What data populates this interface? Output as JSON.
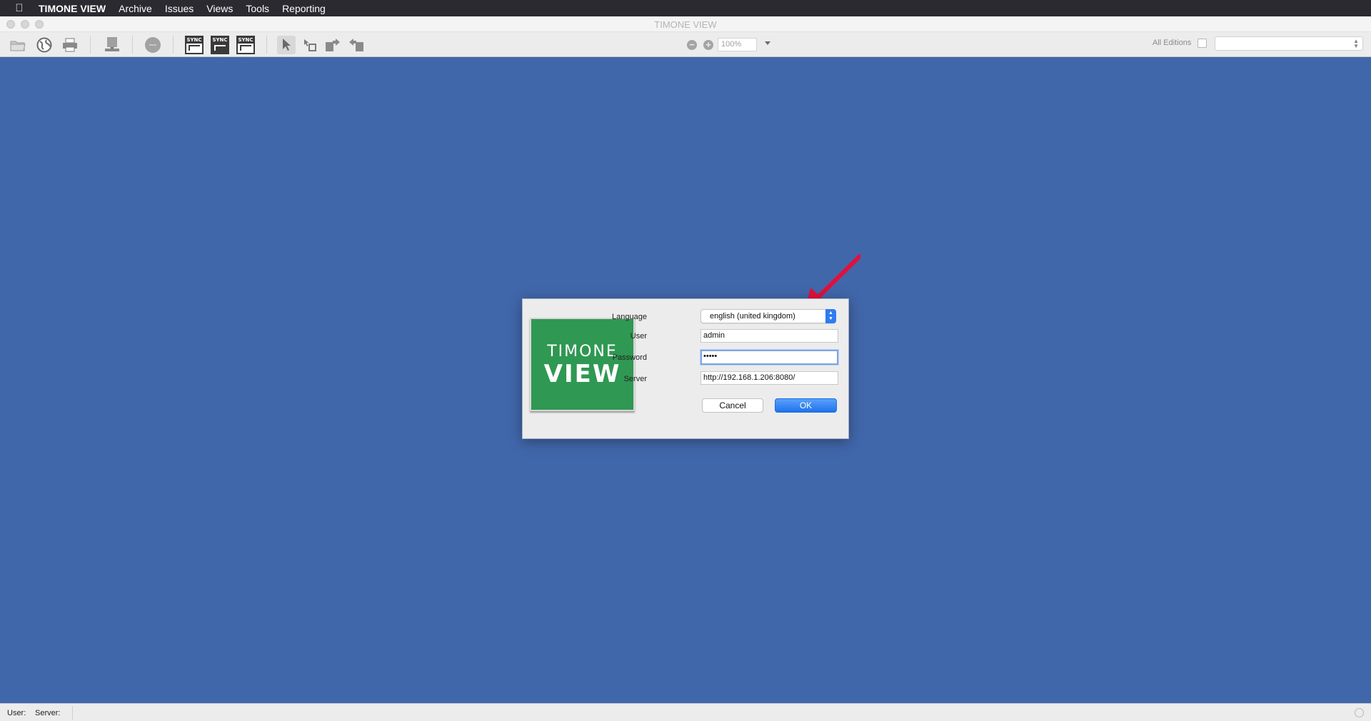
{
  "menubar": {
    "app_name": "TIMONE VIEW",
    "items": [
      "Archive",
      "Issues",
      "Views",
      "Tools",
      "Reporting"
    ]
  },
  "window": {
    "title": "TIMONE VIEW"
  },
  "toolbar": {
    "sync_label": "SYNC",
    "zoom_value": "100%",
    "all_editions_label": "All Editions",
    "all_editions_checked": false,
    "edition_selected": ""
  },
  "dialog": {
    "logo_line1": "TIMONE",
    "logo_line2": "VIEW",
    "language_label": "Language",
    "language_value": "english (united kingdom)",
    "user_label": "User",
    "user_value": "admin",
    "password_label": "Password",
    "password_masked": "•••••",
    "server_label": "Server",
    "server_value": "http://192.168.1.206:8080/",
    "cancel_label": "Cancel",
    "ok_label": "OK"
  },
  "statusbar": {
    "user_label": "User:",
    "server_label": "Server:"
  },
  "colors": {
    "desktop_bg": "#4167ab",
    "logo_green": "#2f9852",
    "accent_blue": "#2f7bf2",
    "annotation_red": "#e0103c"
  }
}
